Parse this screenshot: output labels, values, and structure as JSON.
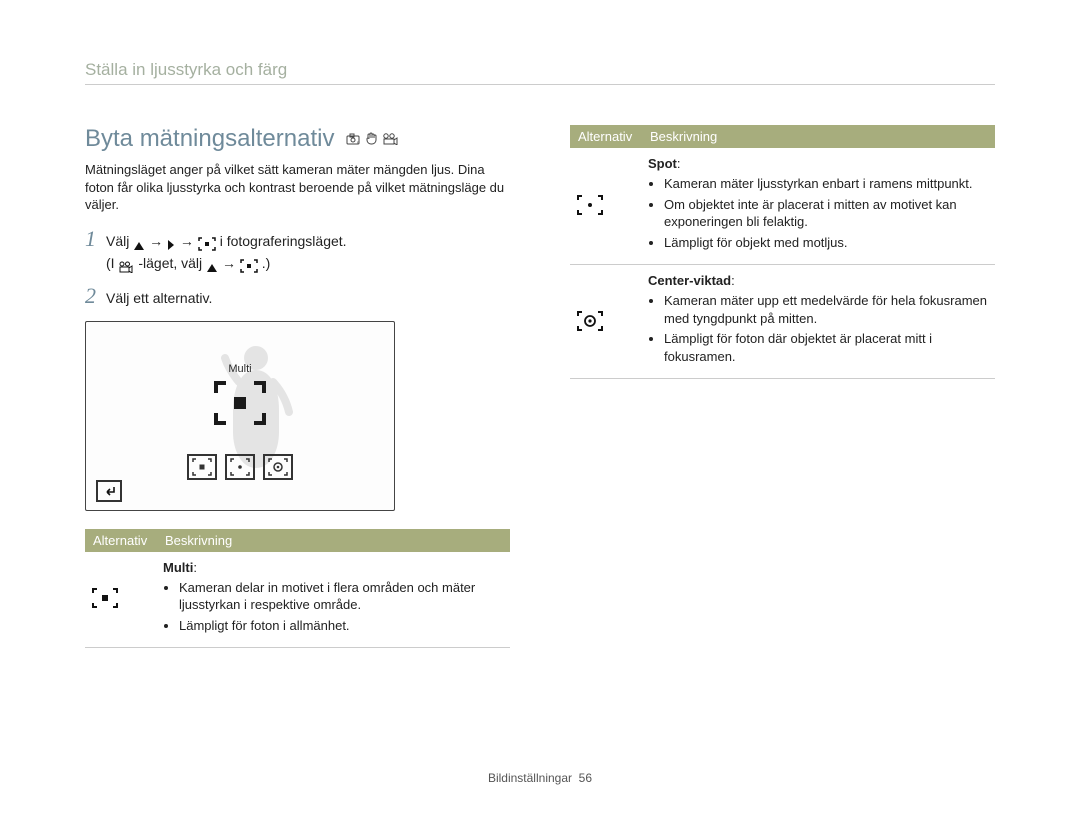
{
  "breadcrumb": "Ställa in ljusstyrka och färg",
  "section_title": "Byta mätningsalternativ",
  "intro": "Mätningsläget anger på vilket sätt kameran mäter mängden ljus. Dina foton får olika ljusstyrka och kontrast beroende på vilket mätningsläge du väljer.",
  "steps": {
    "1": {
      "num": "1",
      "a": "Välj ",
      "b": " i fotograferingsläget.",
      "c": "(I ",
      "d": " -läget, välj ",
      "e": ".)"
    },
    "2": {
      "num": "2",
      "text": "Välj ett alternativ."
    }
  },
  "display": {
    "label": "Multi"
  },
  "left_table": {
    "headers": {
      "alt": "Alternativ",
      "desc": "Beskrivning"
    },
    "row1": {
      "name": "Multi",
      "b1": "Kameran delar in motivet i flera områden och mäter ljusstyrkan i respektive område.",
      "b2": "Lämpligt för foton i allmänhet."
    }
  },
  "right_table": {
    "headers": {
      "alt": "Alternativ",
      "desc": "Beskrivning"
    },
    "row1": {
      "name": "Spot",
      "b1": "Kameran mäter ljusstyrkan enbart i ramens mittpunkt.",
      "b2": "Om objektet inte är placerat i mitten av motivet kan exponeringen bli felaktig.",
      "b3": "Lämpligt för objekt med motljus."
    },
    "row2": {
      "name": "Center-viktad",
      "b1": "Kameran mäter upp ett medelvärde för hela fokusramen med tyngdpunkt på mitten.",
      "b2": "Lämpligt för foton där objektet är placerat mitt i fokusramen."
    }
  },
  "footer": {
    "label": "Bildinställningar",
    "page": "56"
  }
}
